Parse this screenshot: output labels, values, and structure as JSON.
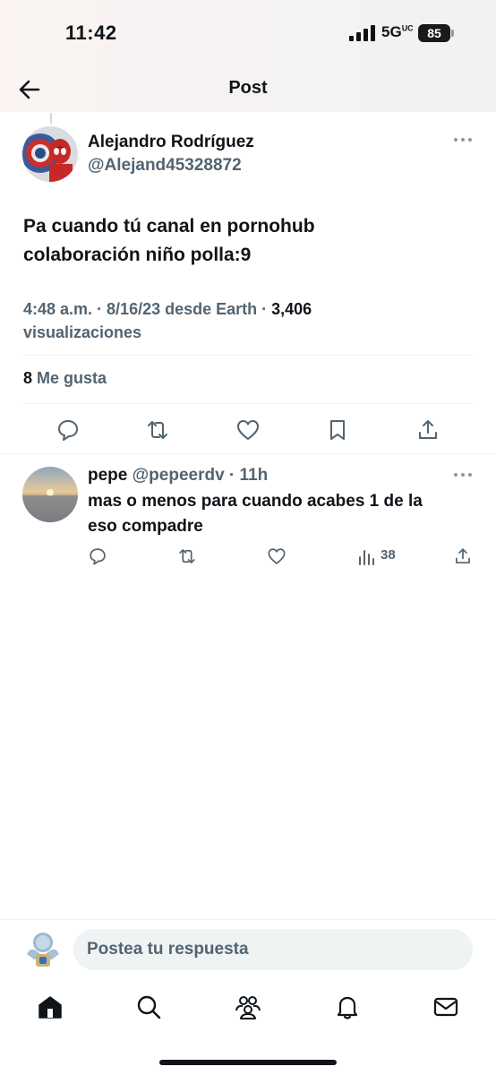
{
  "status_bar": {
    "time": "11:42",
    "network": "5G",
    "network_suffix": "UC",
    "battery": "85"
  },
  "header": {
    "title": "Post"
  },
  "tweet": {
    "author_name": "Alejandro Rodríguez",
    "author_handle": "@Alejand45328872",
    "text_line1": "Pa cuando tú canal en pornohub",
    "text_line2": "colaboración niño polla:9",
    "time": "4:48 a.m.",
    "date_source": "8/16/23 desde Earth",
    "views_count": "3,406",
    "views_label": "visualizaciones",
    "likes_count": "8",
    "likes_label": "Me gusta"
  },
  "reply": {
    "name": "pepe",
    "handle": "@pepeerdv",
    "time": "11h",
    "text_line1": "mas o menos para cuando acabes 1 de la",
    "text_line2": "eso compadre",
    "views": "38"
  },
  "compose": {
    "placeholder": "Postea tu respuesta"
  },
  "icons": {
    "back": "arrow-left-icon",
    "more": "more-horizontal-icon",
    "reply": "comment-icon",
    "retweet": "repost-icon",
    "like": "heart-icon",
    "bookmark": "bookmark-icon",
    "share": "share-icon",
    "views": "analytics-icon",
    "home": "home-icon",
    "search": "search-icon",
    "communities": "communities-icon",
    "notifications": "bell-icon",
    "messages": "mail-icon"
  },
  "colors": {
    "text": "#0f1419",
    "muted": "#536471",
    "divider": "#eff3f4"
  }
}
